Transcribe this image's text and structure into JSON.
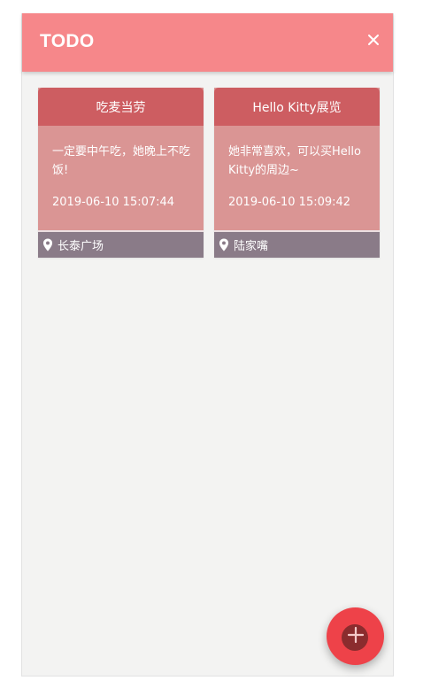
{
  "header": {
    "title": "TODO",
    "close_icon": "close-icon",
    "background": "#f6878a"
  },
  "cards": [
    {
      "title": "吃麦当劳",
      "description": "一定要中午吃，她晚上不吃饭!",
      "time": "2019-06-10 15:07:44",
      "location": "长泰广场",
      "location_icon": "location-pin-icon"
    },
    {
      "title": "Hello Kitty展览",
      "description": "她非常喜欢，可以买Hello Kitty的周边~",
      "time": "2019-06-10 15:09:42",
      "location": "陆家嘴",
      "location_icon": "location-pin-icon"
    }
  ],
  "fab": {
    "icon": "plus-icon",
    "color": "#ee4249"
  },
  "colors": {
    "card_header": "#cd5d61",
    "card_body": "#da9594",
    "card_footer": "#8a7b88",
    "page_background": "#f3f3f2"
  }
}
